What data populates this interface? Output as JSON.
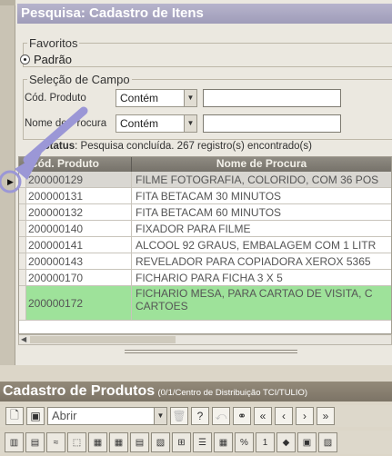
{
  "title": "Pesquisa: Cadastro de Itens",
  "favoritos": {
    "legend": "Favoritos",
    "option": "Padrão"
  },
  "selecao": {
    "legend": "Seleção de Campo",
    "fields": [
      {
        "label": "Cód. Produto",
        "operator": "Contém",
        "value": ""
      },
      {
        "label": "Nome de Procura",
        "operator": "Contém",
        "value": ""
      }
    ]
  },
  "status": {
    "prefix": "Status",
    "text": ": Pesquisa concluída. 267 registro(s) encontrado(s)"
  },
  "grid": {
    "columns": [
      "Cód. Produto",
      "Nome de Procura"
    ],
    "rows": [
      {
        "code": "200000129",
        "name": "FILME FOTOGRAFIA, COLORIDO, COM 36 POS"
      },
      {
        "code": "200000131",
        "name": "FITA BETACAM 30 MINUTOS"
      },
      {
        "code": "200000132",
        "name": "FITA BETACAM 60 MINUTOS"
      },
      {
        "code": "200000140",
        "name": "FIXADOR PARA FILME"
      },
      {
        "code": "200000141",
        "name": "ALCOOL 92 GRAUS, EMBALAGEM COM 1 LITR"
      },
      {
        "code": "200000143",
        "name": "REVELADOR PARA COPIADORA XEROX 5365"
      },
      {
        "code": "200000170",
        "name": "FICHARIO PARA FICHA 3 X 5"
      },
      {
        "code": "200000172",
        "name": "FICHARIO MESA, PARA CARTAO DE VISITA, C CARTOES"
      }
    ]
  },
  "bottom": {
    "title": "Cadastro de Produtos",
    "subtitle": "(0/1/Centro de Distribuição TCI/TULIO)",
    "abrir": "Abrir"
  },
  "colors": {
    "title_bg": "#a9a6c2",
    "selected_row": "#9ee29a",
    "annotation_arrow": "#9b97d6"
  }
}
